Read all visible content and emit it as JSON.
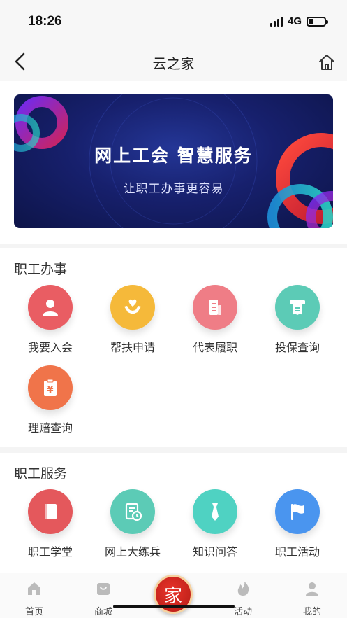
{
  "status_bar": {
    "time": "18:26",
    "network": "4G",
    "battery_level": 0.3
  },
  "nav": {
    "title": "云之家",
    "back_icon": "chevron-left-icon",
    "home_icon": "home-icon"
  },
  "banner": {
    "headline": "网上工会 智慧服务",
    "subline": "让职工办事更容易"
  },
  "section_affairs": {
    "title": "职工办事",
    "items": [
      {
        "label": "我要入会",
        "icon": "user-icon",
        "color": "#e95d63"
      },
      {
        "label": "帮扶申请",
        "icon": "heart-hands-icon",
        "color": "#f5b93a"
      },
      {
        "label": "代表履职",
        "icon": "document-icon",
        "color": "#ef7d86"
      },
      {
        "label": "投保查询",
        "icon": "receipt-icon",
        "color": "#5ccbb6"
      },
      {
        "label": "理赔查询",
        "icon": "yen-clipboard-icon",
        "color": "#f0744a"
      }
    ]
  },
  "section_services": {
    "title": "职工服务",
    "items": [
      {
        "label": "职工学堂",
        "icon": "book-icon",
        "color": "#e4585c"
      },
      {
        "label": "网上大练兵",
        "icon": "schedule-icon",
        "color": "#5ccbb6"
      },
      {
        "label": "知识问答",
        "icon": "tie-icon",
        "color": "#4fd2c2"
      },
      {
        "label": "职工活动",
        "icon": "flag-icon",
        "color": "#4a95ef"
      }
    ]
  },
  "tabbar": {
    "items": [
      {
        "label": "首页",
        "icon": "home-tab-icon"
      },
      {
        "label": "商城",
        "icon": "bag-icon"
      },
      {
        "label": "活动",
        "icon": "flame-icon"
      },
      {
        "label": "我的",
        "icon": "profile-icon"
      }
    ],
    "center_label": "家"
  }
}
